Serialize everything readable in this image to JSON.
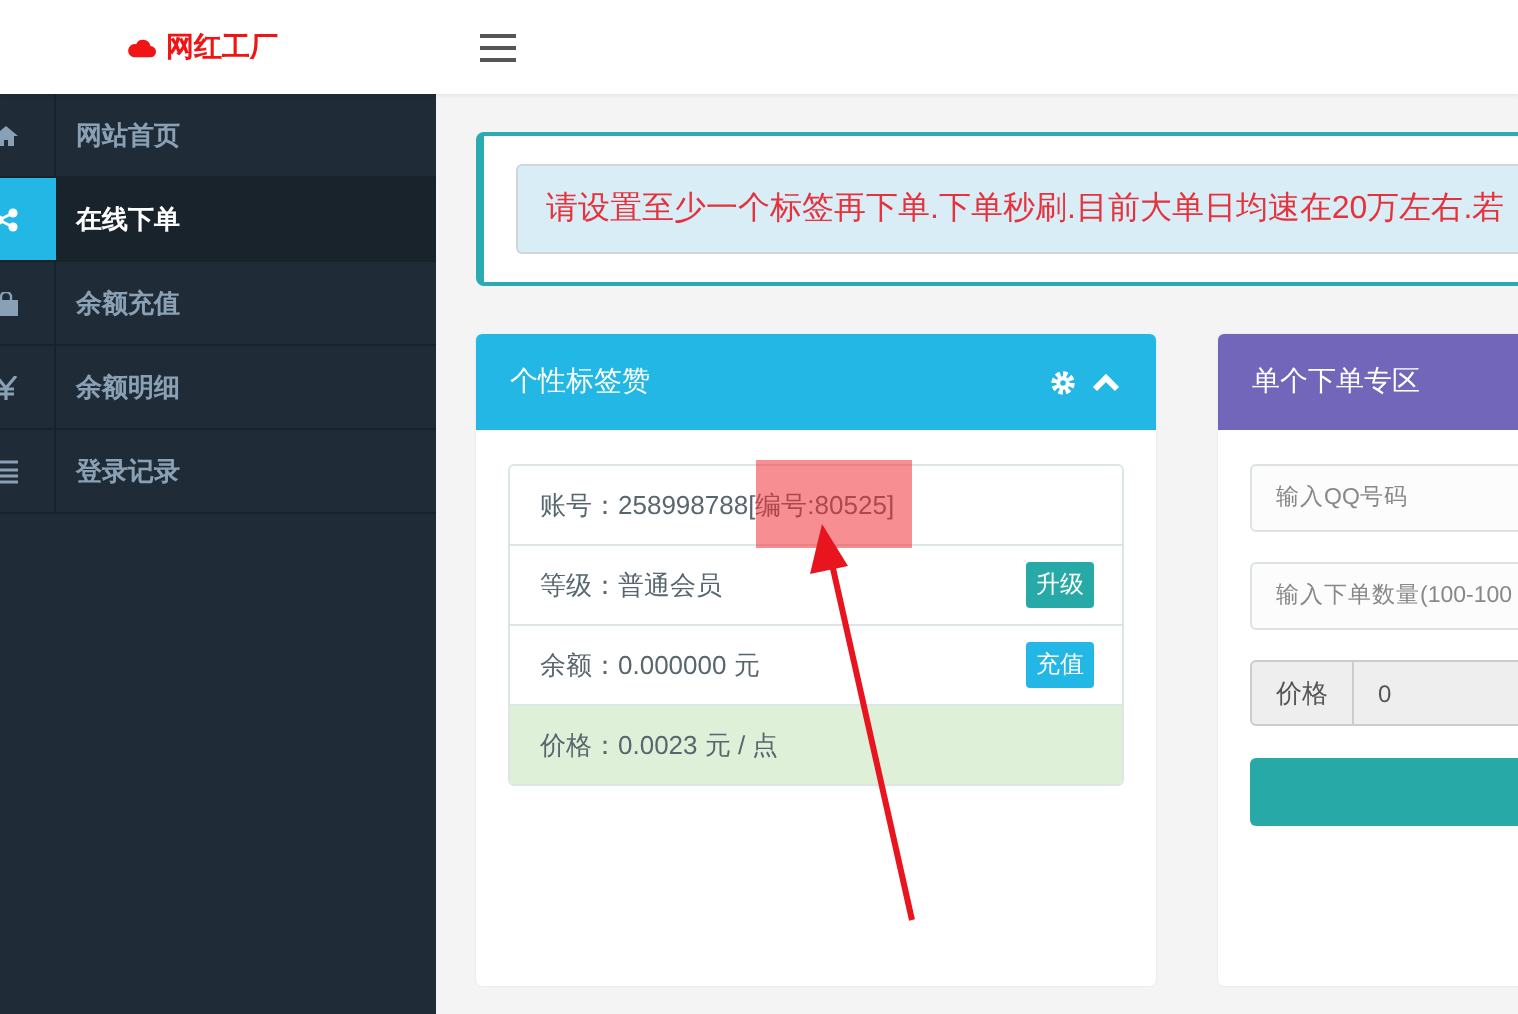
{
  "brand": {
    "name": "网红工厂"
  },
  "sidebar": {
    "items": [
      {
        "label": "网站首页",
        "selected": false
      },
      {
        "label": "在线下单",
        "selected": true
      },
      {
        "label": "余额充值",
        "selected": false
      },
      {
        "label": "余额明细",
        "selected": false
      },
      {
        "label": "登录记录",
        "selected": false
      }
    ]
  },
  "notice": {
    "text": "请设置至少一个标签再下单.下单秒刷.目前大单日均速在20万左右.若"
  },
  "tag_card": {
    "title": "个性标签赞",
    "rows": [
      {
        "kind": "plain",
        "text": "账号：258998788[编号:80525]"
      },
      {
        "kind": "action",
        "text": "等级：普通会员",
        "button": "升级",
        "color": "#27a9a8"
      },
      {
        "kind": "action",
        "text": "余额：0.000000 元",
        "button": "充值",
        "color": "#23b7e5"
      },
      {
        "kind": "highlight",
        "text": "价格：0.0023 元 / 点"
      }
    ]
  },
  "order_card": {
    "title": "单个下单专区",
    "fields": [
      {
        "placeholder": "输入QQ号码"
      },
      {
        "placeholder": "输入下单数量(100-100"
      }
    ],
    "price": {
      "label": "价格",
      "value": "0"
    }
  }
}
